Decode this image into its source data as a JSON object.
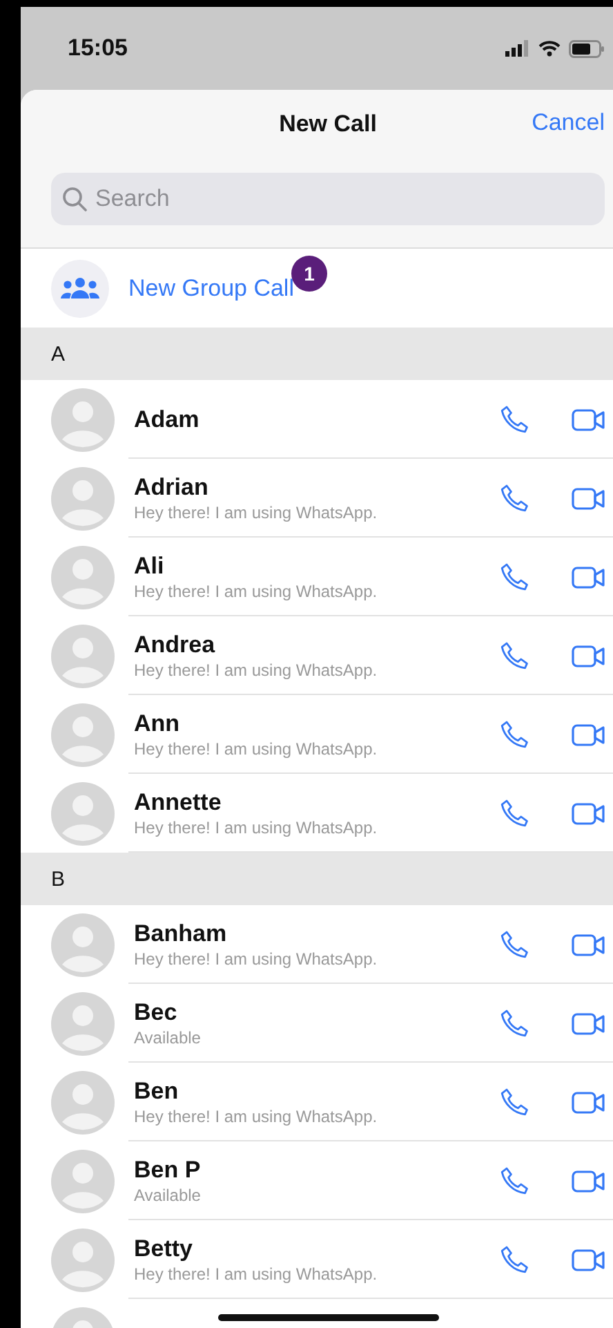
{
  "status_bar": {
    "time": "15:05"
  },
  "header": {
    "title": "New Call",
    "cancel": "Cancel"
  },
  "search": {
    "placeholder": "Search"
  },
  "new_group_call": {
    "label": "New Group Call",
    "badge": "1"
  },
  "sections": [
    {
      "letter": "A",
      "contacts": [
        {
          "name": "Adam"
        },
        {
          "name": "Adrian",
          "status": "Hey there! I am using WhatsApp."
        },
        {
          "name": "Ali",
          "status": "Hey there! I am using WhatsApp."
        },
        {
          "name": "Andrea",
          "status": "Hey there! I am using WhatsApp."
        },
        {
          "name": "Ann",
          "status": "Hey there! I am using WhatsApp."
        },
        {
          "name": "Annette",
          "status": "Hey there! I am using WhatsApp."
        }
      ]
    },
    {
      "letter": "B",
      "contacts": [
        {
          "name": "Banham",
          "status": "Hey there! I am using WhatsApp."
        },
        {
          "name": "Bec",
          "status": "Available"
        },
        {
          "name": "Ben",
          "status": "Hey there! I am using WhatsApp."
        },
        {
          "name": "Ben P",
          "status": "Available"
        },
        {
          "name": "Betty",
          "status": "Hey there! I am using WhatsApp."
        }
      ]
    }
  ]
}
